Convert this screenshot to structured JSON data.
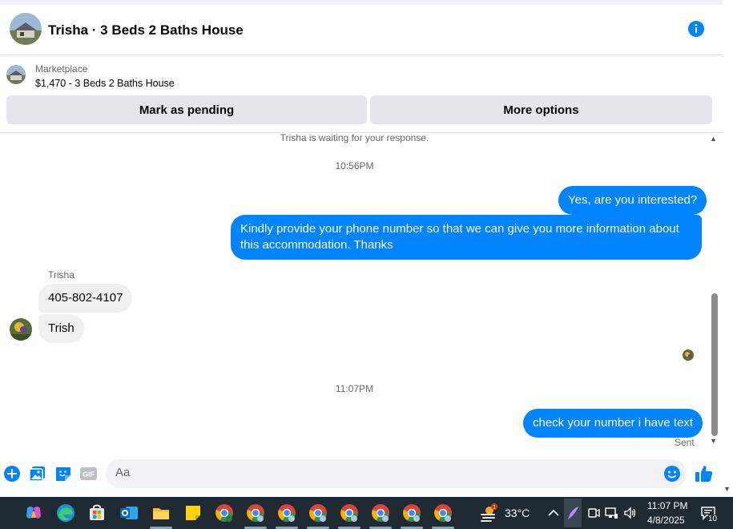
{
  "header": {
    "title": "Trisha · 3 Beds 2 Baths House",
    "info_icon": "info-icon"
  },
  "marketplace": {
    "label": "Marketplace",
    "listing": "$1,470 - 3 Beds 2 Baths House",
    "mark_pending_label": "Mark as pending",
    "more_options_label": "More options"
  },
  "conversation": {
    "waiting_notice": "Trisha is waiting for your response.",
    "timestamp_1": "10:56PM",
    "out_1": "Yes, are you interested?",
    "out_2": "Kindly provide your phone number so that we can give you more information about this accommodation. Thanks",
    "sender_name": "Trisha",
    "in_1": "405-802-4107",
    "in_2": "Trish",
    "timestamp_2": "11:07PM",
    "out_3": "check your number i have text",
    "status": "Sent"
  },
  "composer": {
    "placeholder": "Aa",
    "icons": [
      "plus-icon",
      "photo-icon",
      "sticker-icon",
      "gif-icon",
      "emoji-icon",
      "like-icon"
    ]
  },
  "taskbar": {
    "temperature": "33°C",
    "weather_badge": "1",
    "time": "11:07 PM",
    "date": "4/8/2025",
    "notifications": "10"
  },
  "colors": {
    "accent": "#0084ff",
    "bubble_in": "#f0f0f0",
    "button_bg": "#e4e6eb",
    "taskbar": "#1f2a33"
  }
}
